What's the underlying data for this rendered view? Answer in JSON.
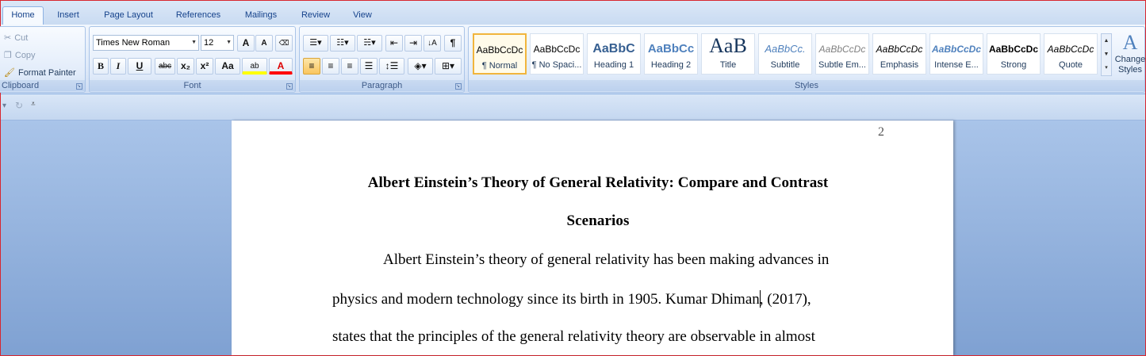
{
  "tabs": [
    "Home",
    "Insert",
    "Page Layout",
    "References",
    "Mailings",
    "Review",
    "View"
  ],
  "clipboard": {
    "cut": "Cut",
    "copy": "Copy",
    "format_painter": "Format Painter",
    "label": "Clipboard"
  },
  "font": {
    "name": "Times New Roman",
    "size": "12",
    "label": "Font",
    "grow": "A",
    "shrink": "A",
    "bold": "B",
    "italic": "I",
    "underline": "U",
    "strike": "abc",
    "subscript": "x₂",
    "superscript": "x²",
    "change_case": "Aa",
    "highlight": "ab",
    "color": "A"
  },
  "paragraph": {
    "label": "Paragraph",
    "pilcrow": "¶"
  },
  "styles": {
    "label": "Styles",
    "items": [
      {
        "sample": "AaBbCcDc",
        "name": "¶ Normal"
      },
      {
        "sample": "AaBbCcDc",
        "name": "¶ No Spaci..."
      },
      {
        "sample": "AaBbC",
        "name": "Heading 1"
      },
      {
        "sample": "AaBbCc",
        "name": "Heading 2"
      },
      {
        "sample": "AaB",
        "name": "Title"
      },
      {
        "sample": "AaBbCc.",
        "name": "Subtitle"
      },
      {
        "sample": "AaBbCcDc",
        "name": "Subtle Em..."
      },
      {
        "sample": "AaBbCcDc",
        "name": "Emphasis"
      },
      {
        "sample": "AaBbCcDc",
        "name": "Intense E..."
      },
      {
        "sample": "AaBbCcDc",
        "name": "Strong"
      },
      {
        "sample": "AaBbCcDc",
        "name": "Quote"
      }
    ],
    "change_styles_1": "Change",
    "change_styles_2": "Styles"
  },
  "document": {
    "page_number": "2",
    "title_line1": "Albert Einstein’s Theory of General Relativity: Compare and Contrast",
    "title_line2": "Scenarios",
    "line1": "Albert Einstein’s theory of general relativity has been making advances in",
    "line2a": "physics and modern technology since its birth in 1905. Kumar Dhiman",
    "line2b": ", (2017),",
    "line3": "states that the principles of the general relativity theory are observable in almost"
  },
  "colors": {
    "accent": "#15428b",
    "highlight": "#ffff00",
    "font_color": "#ff0000",
    "selected_style_border": "#f1b53d"
  }
}
